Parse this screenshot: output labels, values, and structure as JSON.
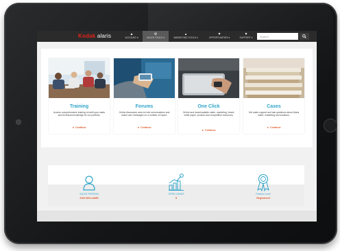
{
  "header": {
    "logo_brand": "Kodak",
    "logo_product": "alaris",
    "nav": [
      {
        "label": "ACCOUNT ▾",
        "icon": "person-icon"
      },
      {
        "label": "SALES TOOLS ▾",
        "icon": "tools-icon"
      },
      {
        "label": "MARKETING TOOLS ▾",
        "icon": "megaphone-icon"
      },
      {
        "label": "OPPORTUNITIES ▾",
        "icon": "trophy-icon"
      },
      {
        "label": "SUPPORT ▾",
        "icon": "support-icon"
      }
    ],
    "search_placeholder": "Search"
  },
  "cards": [
    {
      "title": "Training",
      "description": "Access comprehensive training to build your sales and technical knowledge for our portfolio.",
      "link": "► Continue"
    },
    {
      "title": "Forums",
      "description": "Online discussion area to hold conversations and share user messages on a number of topics.",
      "link": "► Continue"
    },
    {
      "title": "One Click",
      "description": "Online and downloadable sales, marketing, brand, white paper, product and competitive resources.",
      "link": "► Continue"
    },
    {
      "title": "Cases",
      "description": "Get sales support and ask questions about Alaris sales, marketing and solutions.",
      "link": "► Continue"
    }
  ],
  "stats": [
    {
      "label": "SALES PERSON",
      "value": "JON WILLIAMS",
      "icon": "person-outline-icon"
    },
    {
      "label": "OPEN LEADS",
      "value": "5",
      "icon": "growth-chart-icon"
    },
    {
      "label": "Partner Level",
      "value": "Registered",
      "icon": "award-ribbon-icon"
    }
  ],
  "colors": {
    "accent_blue": "#2fa4c9",
    "accent_orange": "#e05a2a",
    "brand_red": "#e2231a",
    "nav_bg": "#2b2b2b"
  }
}
